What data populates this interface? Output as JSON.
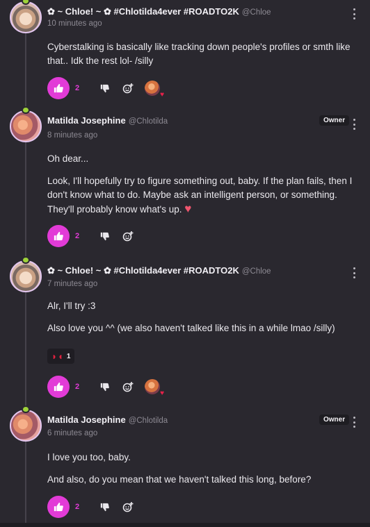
{
  "comments": [
    {
      "name": "✿ ~ Chloe! ~ ✿ #Chlotilda4ever #ROADTO2K",
      "handle": "@Chloe",
      "time": "10 minutes ago",
      "paragraphs": [
        "Cyberstalking is basically like tracking down people's profiles or smth like that.. Idk the rest lol- /silly"
      ],
      "likes": "2",
      "owner": ""
    },
    {
      "name": "Matilda Josephine",
      "handle": "@Chlotilda",
      "time": "8 minutes ago",
      "paragraphs": [
        "Oh dear...",
        "Look, I'll hopefully try to figure something out, baby. If the plan fails, then I don't know what to do. Maybe ask an intelligent person, or something. They'll probably know what's up."
      ],
      "likes": "2",
      "owner": "Owner"
    },
    {
      "name": "✿ ~ Chloe! ~ ✿ #Chlotilda4ever #ROADTO2K",
      "handle": "@Chloe",
      "time": "7 minutes ago",
      "paragraphs": [
        "Alr, I'll try :3",
        "Also love you ^^ (we also haven't talked like this in a while lmao /silly)"
      ],
      "reaction_count": "1",
      "likes": "2",
      "owner": ""
    },
    {
      "name": "Matilda Josephine",
      "handle": "@Chlotilda",
      "time": "6 minutes ago",
      "paragraphs": [
        "I love you too, baby.",
        "And also, do you mean that we haven't talked this long, before?"
      ],
      "likes": "2",
      "owner": "Owner"
    }
  ],
  "colors": {
    "accent": "#e23bd7",
    "background": "#2a282f"
  }
}
